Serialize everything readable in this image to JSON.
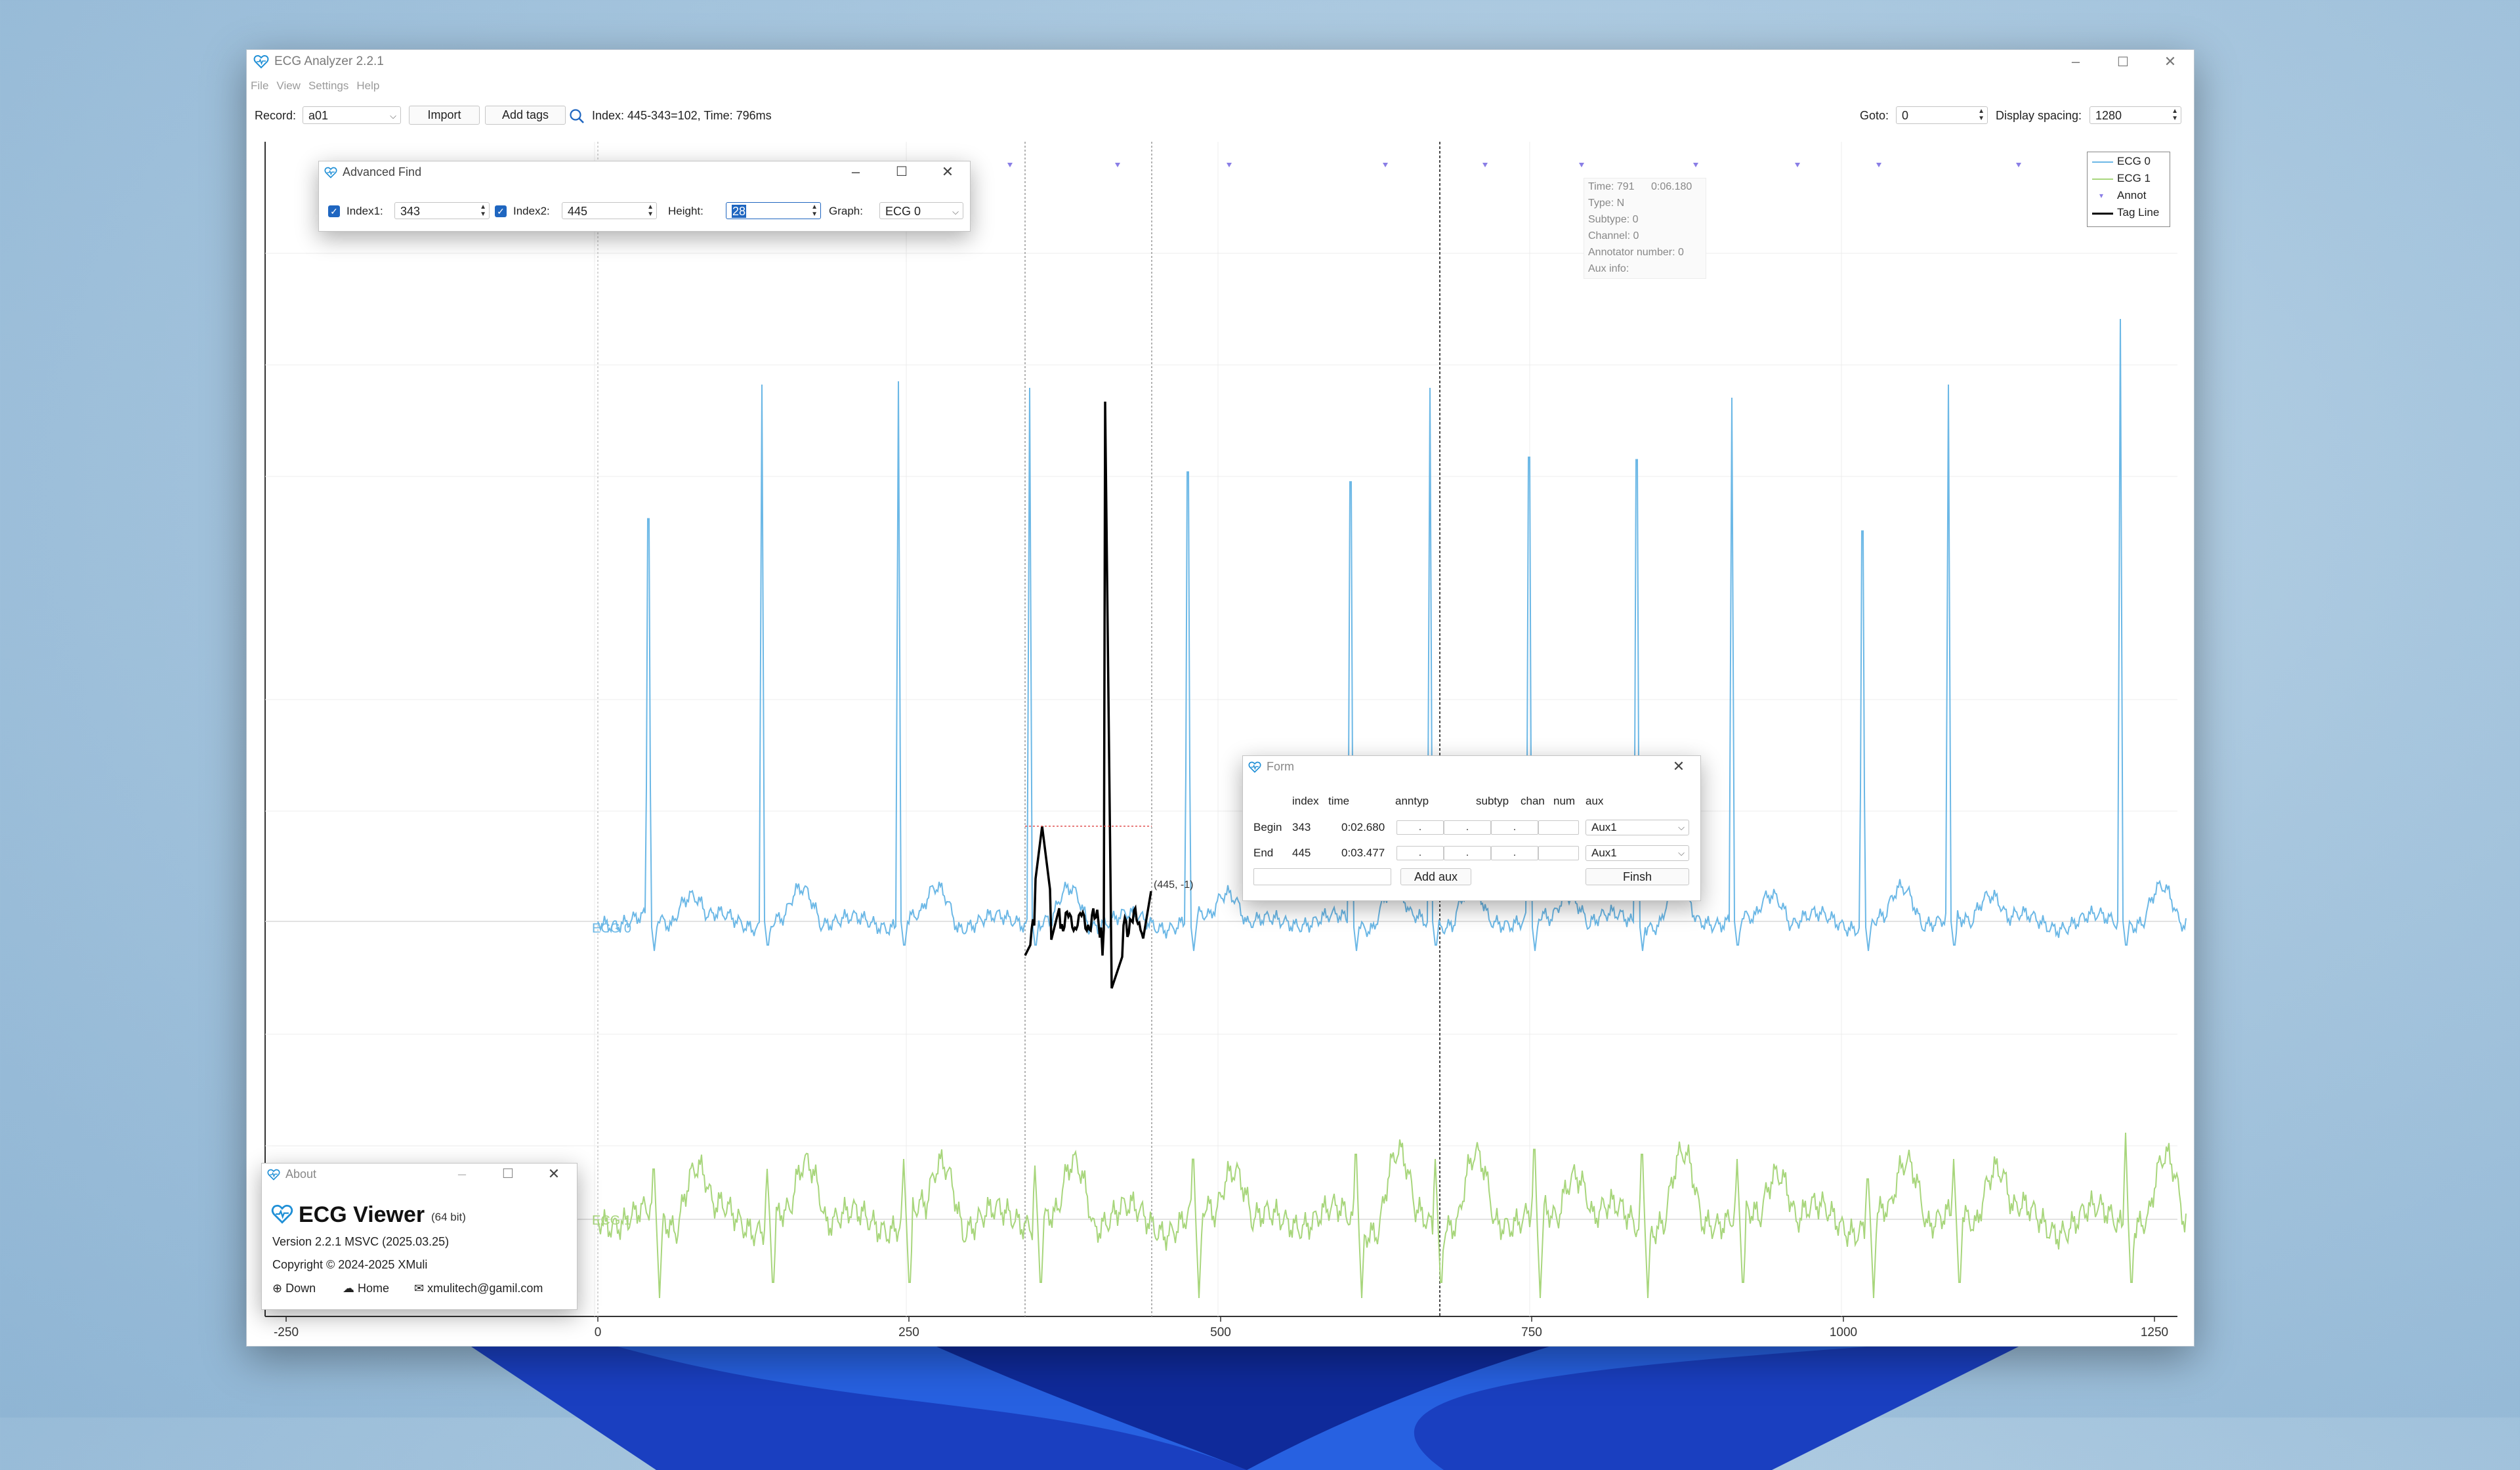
{
  "window": {
    "title": "ECG Analyzer 2.2.1",
    "menu": [
      "File",
      "View",
      "Settings",
      "Help"
    ]
  },
  "toolbar": {
    "record_label": "Record:",
    "record_value": "a01",
    "import_label": "Import",
    "add_tags_label": "Add tags",
    "status_text": "Index: 445-343=102, Time: 796ms",
    "goto_label": "Goto:",
    "goto_value": "0",
    "spacing_label": "Display spacing:",
    "spacing_value": "1280"
  },
  "plot": {
    "x_ticks": [
      "-250",
      "0",
      "250",
      "500",
      "750",
      "1000",
      "1250"
    ],
    "channel_labels": [
      "ECG 0",
      "ECG 1"
    ],
    "point_label": "(445, -1)",
    "legend": [
      {
        "label": "ECG 0",
        "color": "#6cb8e6"
      },
      {
        "label": "ECG 1",
        "color": "#a8d67c"
      },
      {
        "label": "Annot",
        "color": "#8a7ee6"
      },
      {
        "label": "Tag Line",
        "color": "#000000"
      }
    ],
    "tooltip": {
      "time_label": "Time: 791",
      "time_value": "0:06.180",
      "type": "Type: N",
      "subtype": "Subtype: 0",
      "channel": "Channel: 0",
      "annotator": "Annotator number: 0",
      "aux": "Aux info:"
    }
  },
  "advanced_find": {
    "title": "Advanced Find",
    "index1_label": "Index1:",
    "index1_value": "343",
    "index2_label": "Index2:",
    "index2_value": "445",
    "height_label": "Height:",
    "height_value": "28",
    "graph_label": "Graph:",
    "graph_value": "ECG 0"
  },
  "form": {
    "title": "Form",
    "headers": [
      "index",
      "time",
      "anntyp",
      "subtyp",
      "chan",
      "num",
      "aux"
    ],
    "rows": [
      {
        "label": "Begin",
        "index": "343",
        "time": "0:02.680",
        "anntyp": ".",
        "subtyp": ".",
        "chan": ".",
        "aux": "Aux1"
      },
      {
        "label": "End",
        "index": "445",
        "time": "0:03.477",
        "anntyp": ".",
        "subtyp": ".",
        "chan": ".",
        "aux": "Aux1"
      }
    ],
    "add_aux_label": "Add aux",
    "finish_label": "Finsh"
  },
  "about": {
    "title": "About",
    "app_name": "ECG Viewer",
    "bits": "(64 bit)",
    "version": "Version 2.2.1 MSVC (2025.03.25)",
    "copyright": "Copyright © 2024-2025 XMuli",
    "links": [
      "Down",
      "Home",
      "xmulitech@gamil.com"
    ]
  },
  "colors": {
    "ecg0": "#6cb8e6",
    "ecg1": "#a8d67c",
    "annot": "#8a7ee6",
    "accent": "#1f66c0",
    "selected_segment": "#000000"
  }
}
